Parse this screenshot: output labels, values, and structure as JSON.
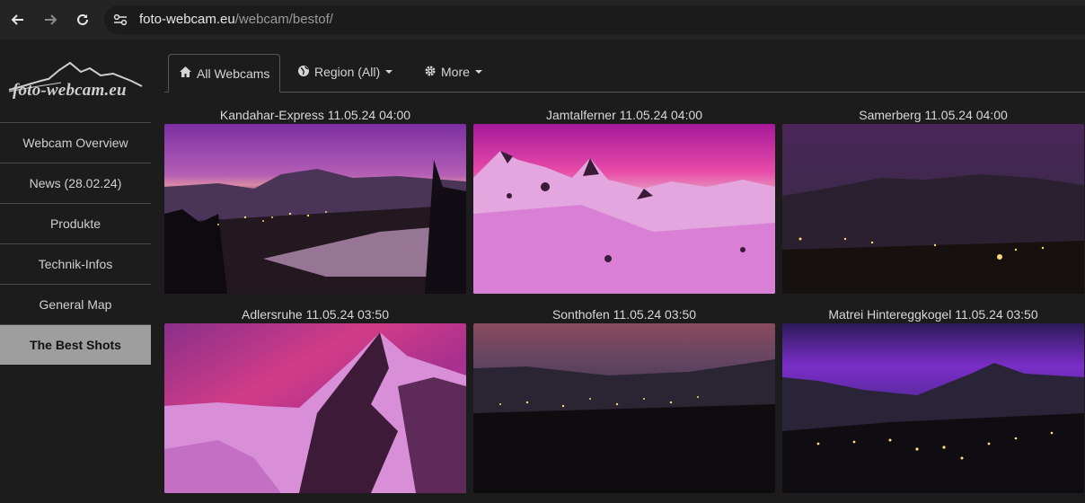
{
  "browser": {
    "url_domain": "foto-webcam.eu",
    "url_path": "/webcam/bestof/"
  },
  "sidebar": {
    "logo_text": "foto-webcam.eu",
    "items": [
      {
        "label": "Webcam Overview",
        "active": false
      },
      {
        "label": "News (28.02.24)",
        "active": false
      },
      {
        "label": "Produkte",
        "active": false
      },
      {
        "label": "Technik-Infos",
        "active": false
      },
      {
        "label": "General Map",
        "active": false
      },
      {
        "label": "The Best Shots",
        "active": true
      }
    ]
  },
  "tabs": [
    {
      "label": "All Webcams",
      "icon": "home-icon",
      "active": true
    },
    {
      "label": "Region (All)",
      "icon": "globe-icon",
      "dropdown": true
    },
    {
      "label": "More",
      "icon": "gear-icon",
      "dropdown": true
    }
  ],
  "webcams": [
    {
      "title": "Kandahar-Express 11.05.24 04:00",
      "scene": "valley-town-twilight"
    },
    {
      "title": "Jamtalferner 11.05.24 04:00",
      "scene": "snowy-peaks-pink"
    },
    {
      "title": "Samerberg 11.05.24 04:00",
      "scene": "village-night"
    },
    {
      "title": "Adlersruhe 11.05.24 03:50",
      "scene": "mountain-peak-aurora"
    },
    {
      "title": "Sonthofen 11.05.24 03:50",
      "scene": "valley-lights"
    },
    {
      "title": "Matrei Hintereggkogel 11.05.24 03:50",
      "scene": "town-aurora"
    }
  ],
  "colors": {
    "background": "#1c1c1c",
    "active_menu": "#9e9e9e",
    "aurora_magenta": "#c02fb8"
  }
}
